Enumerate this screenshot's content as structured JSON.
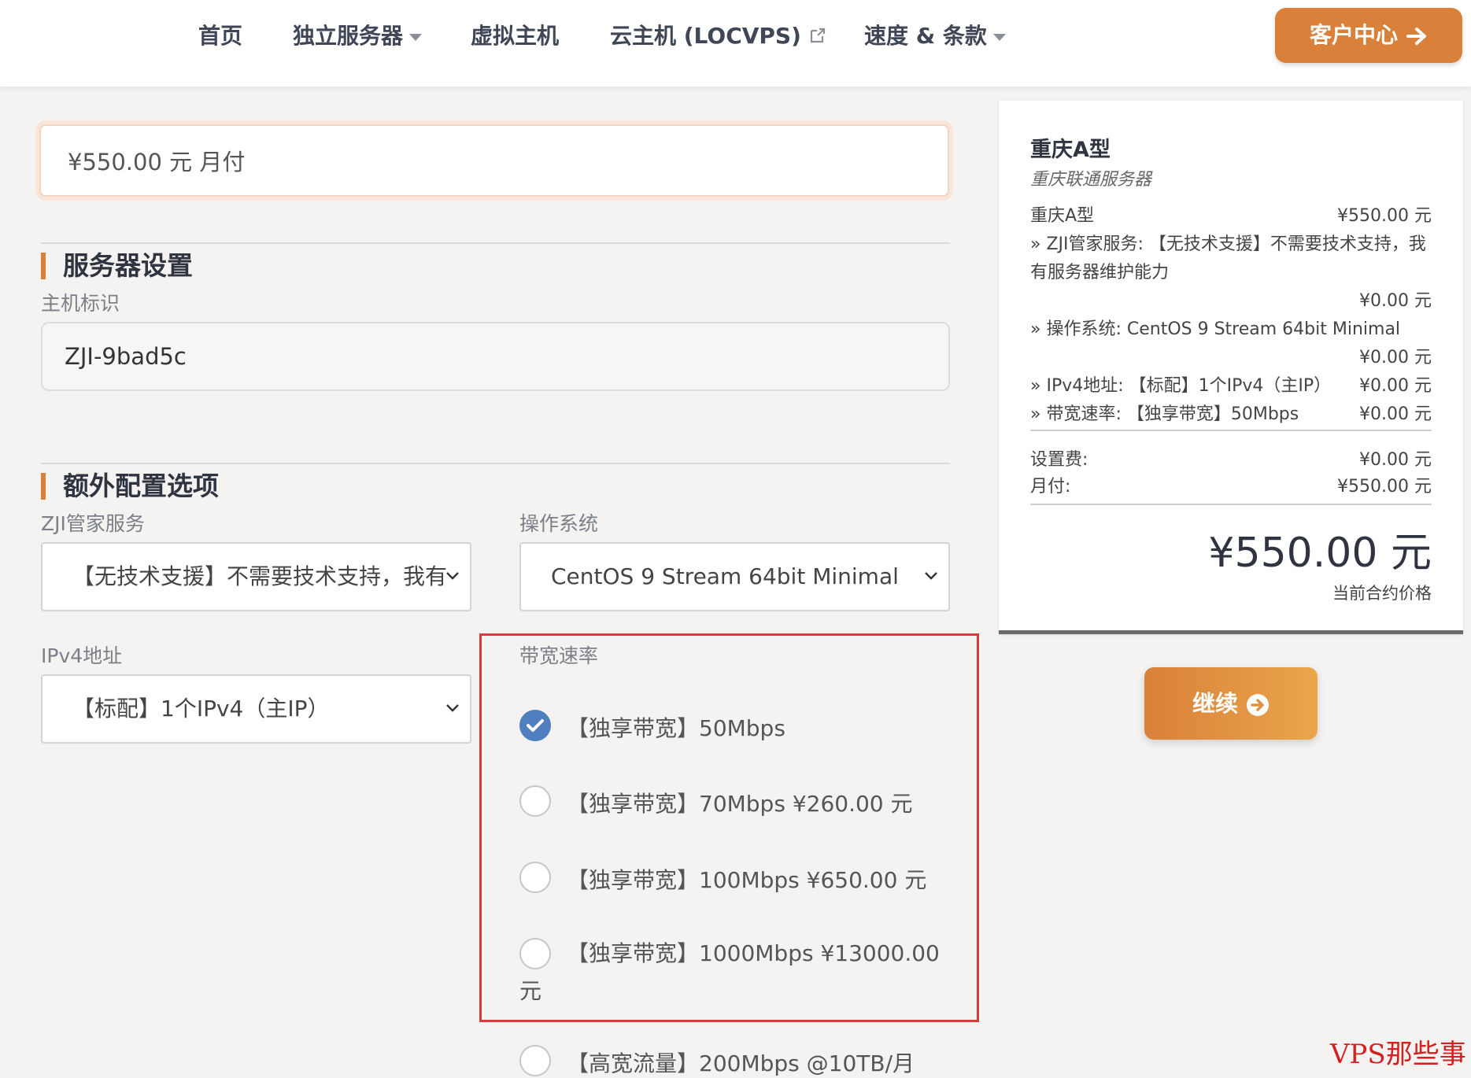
{
  "nav": {
    "home": "首页",
    "dedicated": "独立服务器",
    "vhost": "虚拟主机",
    "cloud": "云主机 (LOCVPS)",
    "speed_terms": "速度 & 条款",
    "client_center": "客户中心"
  },
  "billing": {
    "price_text": "¥550.00 元 月付"
  },
  "server_settings": {
    "title": "服务器设置",
    "hostname_label": "主机标识",
    "hostname_value": "ZJI-9bad5c"
  },
  "extra_options": {
    "title": "额外配置选项",
    "butler_label": "ZJI管家服务",
    "butler_value": "【无技术支援】不需要技术支持，我有",
    "os_label": "操作系统",
    "os_value": "CentOS 9 Stream 64bit Minimal",
    "ipv4_label": "IPv4地址",
    "ipv4_value": "【标配】1个IPv4（主IP）",
    "bandwidth_label": "带宽速率",
    "bandwidth_options": [
      {
        "label": "【独享带宽】50Mbps",
        "checked": true
      },
      {
        "label": "【独享带宽】70Mbps ¥260.00 元",
        "checked": false
      },
      {
        "label": "【独享带宽】100Mbps ¥650.00 元",
        "checked": false
      },
      {
        "label": "【独享带宽】1000Mbps ¥13000.00",
        "label_wrap": "元",
        "checked": false
      },
      {
        "label": "【高宽流量】200Mbps @10TB/月",
        "checked": false
      }
    ]
  },
  "summary": {
    "product_name": "重庆A型",
    "product_group": "重庆联通服务器",
    "lines": {
      "base_label": "重庆A型",
      "base_amount": "¥550.00 元",
      "butler_line1": "» ZJI管家服务: 【无技术支援】不需要技术支持，我",
      "butler_line2": "有服务器维护能力",
      "butler_amount": "¥0.00 元",
      "os_label": "» 操作系统: CentOS 9 Stream 64bit Minimal",
      "os_amount": "¥0.00 元",
      "ipv4_label": "» IPv4地址: 【标配】1个IPv4（主IP）",
      "ipv4_amount": "¥0.00 元",
      "bandwidth_label": "» 带宽速率: 【独享带宽】50Mbps",
      "bandwidth_amount": "¥0.00 元"
    },
    "setup_label": "设置费:",
    "setup_amount": "¥0.00 元",
    "monthly_label": "月付:",
    "monthly_amount": "¥550.00 元",
    "total": "¥550.00 元",
    "total_caption": "当前合约价格"
  },
  "continue_button": "继续",
  "watermark": "VPS那些事",
  "colors": {
    "accent": "#d9803a",
    "radio_checked": "#4f7fbe",
    "highlight_border": "#d83a3a"
  }
}
